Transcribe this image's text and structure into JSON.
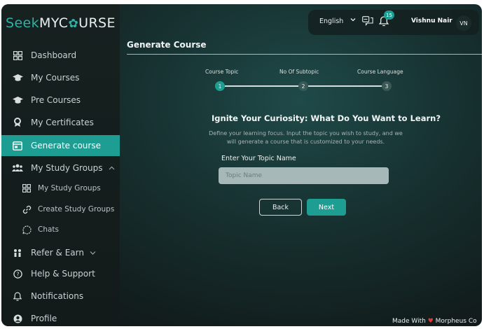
{
  "brand": {
    "seek": "Seek",
    "my": "MYC",
    "gear": "✿",
    "urse": "URSE"
  },
  "sidebar": {
    "items": [
      {
        "label": "Dashboard",
        "icon": "dashboard-icon"
      },
      {
        "label": "My Courses",
        "icon": "graduation-cap-icon"
      },
      {
        "label": "Pre Courses",
        "icon": "graduation-cap-icon"
      },
      {
        "label": "My Certificates",
        "icon": "certificate-icon"
      },
      {
        "label": "Generate course",
        "icon": "generate-icon"
      },
      {
        "label": "My Study Groups",
        "icon": "users-icon"
      },
      {
        "label": "My Study Groups",
        "icon": "grid-icon"
      },
      {
        "label": "Create Study Groups",
        "icon": "link-icon"
      },
      {
        "label": "Chats",
        "icon": "chat-icon"
      },
      {
        "label": "Refer & Earn",
        "icon": "refer-icon"
      },
      {
        "label": "Help & Support",
        "icon": "help-icon"
      },
      {
        "label": "Notifications",
        "icon": "bell-icon"
      },
      {
        "label": "Profile",
        "icon": "user-icon"
      }
    ]
  },
  "header": {
    "language": "English",
    "notification_count": "15",
    "user_name": "Vishnu Nair",
    "user_initials": "VN"
  },
  "page": {
    "title": "Generate Course",
    "steps": [
      {
        "label": "Course Topic",
        "number": "1"
      },
      {
        "label": "No Of Subtopic",
        "number": "2"
      },
      {
        "label": "Course Language",
        "number": "3"
      }
    ],
    "heading": "Ignite Your Curiosity: What Do You Want to Learn?",
    "description": "Define your learning focus. Input the topic you wish to study, and we will generate a course that is customized to your needs.",
    "field_label": "Enter Your Topic Name",
    "input_placeholder": "Topic Name",
    "input_value": "",
    "back_label": "Back",
    "next_label": "Next"
  },
  "footer": {
    "made_with": "Made With",
    "heart": "♥",
    "by": "Morpheus Co"
  },
  "colors": {
    "accent": "#1e9e93",
    "heart": "#e23b3b"
  }
}
